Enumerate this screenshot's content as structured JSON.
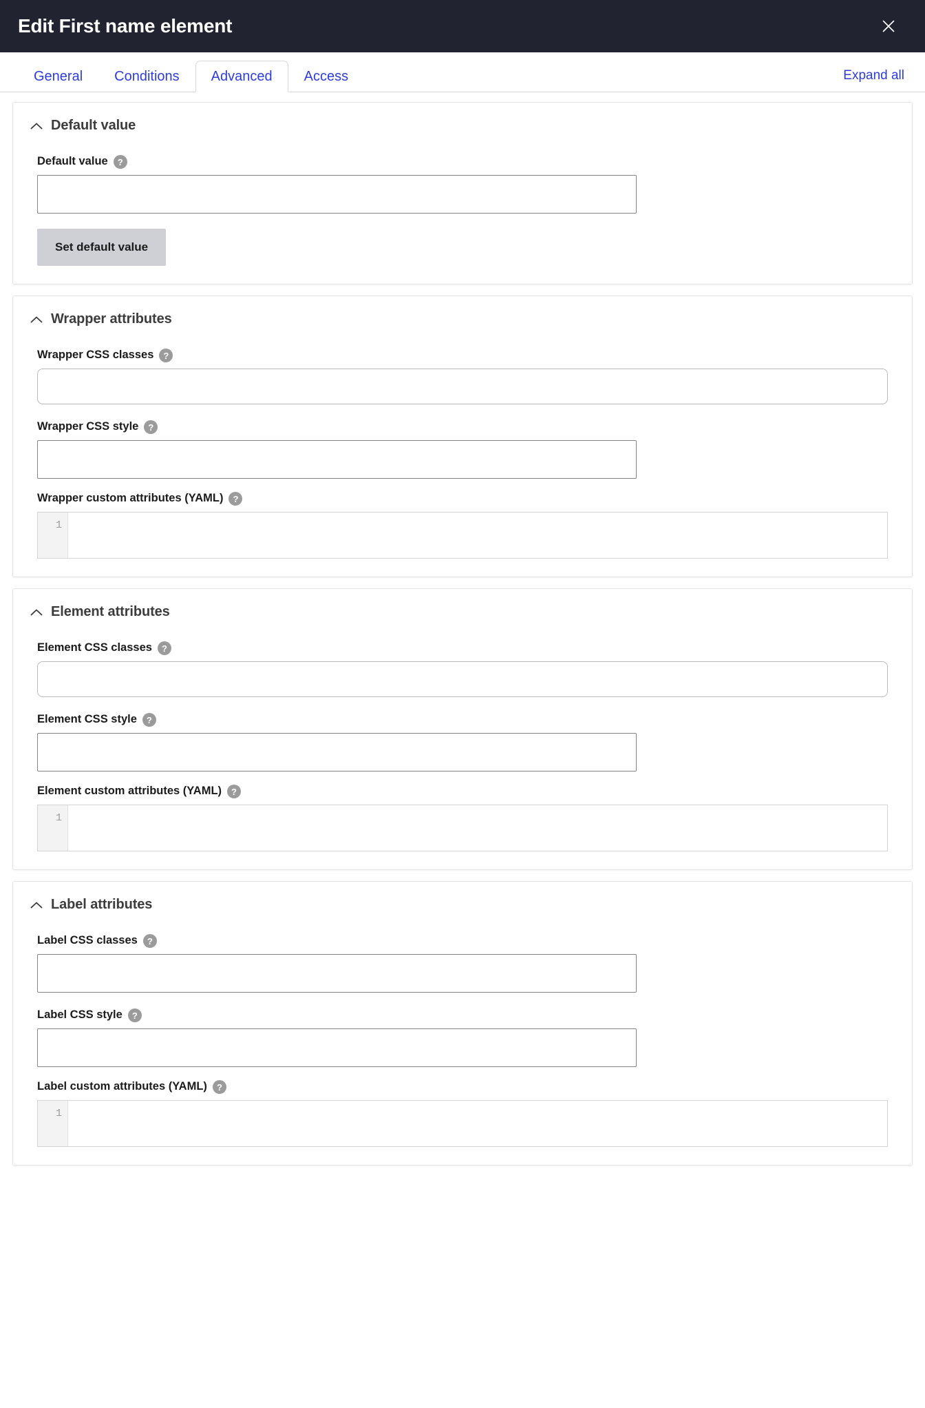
{
  "header": {
    "title": "Edit First name element",
    "close_label": "×",
    "close_icon": "close-icon",
    "background": "#222330"
  },
  "tabs": {
    "items": [
      {
        "label": "General",
        "active": false
      },
      {
        "label": "Conditions",
        "active": false
      },
      {
        "label": "Advanced",
        "active": true
      },
      {
        "label": "Access",
        "active": false
      }
    ],
    "expand_all_label": "Expand all",
    "link_color": "#2c3cdd"
  },
  "panels": [
    {
      "id": "default-value",
      "title": "Default value",
      "chevron_icon": "chevron-up-icon",
      "fields": [
        {
          "id": "default-value",
          "label": "Default value",
          "help_icon": "help-icon",
          "help_glyph": "?",
          "value": "",
          "placeholder": "",
          "kind": "text",
          "width": "medium"
        }
      ],
      "button": {
        "label": "Set default value"
      }
    },
    {
      "id": "wrapper-attributes",
      "title": "Wrapper attributes",
      "chevron_icon": "chevron-up-icon",
      "fields": [
        {
          "id": "wrapper-css-classes",
          "label": "Wrapper CSS classes",
          "help_icon": "help-icon",
          "help_glyph": "?",
          "value": "",
          "placeholder": "",
          "kind": "select",
          "width": "full"
        },
        {
          "id": "wrapper-css-style",
          "label": "Wrapper CSS style",
          "help_icon": "help-icon",
          "help_glyph": "?",
          "value": "",
          "placeholder": "",
          "kind": "text",
          "width": "medium"
        },
        {
          "id": "wrapper-custom-attributes",
          "label": "Wrapper custom attributes (YAML)",
          "help_icon": "help-icon",
          "help_glyph": "?",
          "value": "",
          "kind": "code",
          "line_number": "1",
          "width": "full"
        }
      ]
    },
    {
      "id": "element-attributes",
      "title": "Element attributes",
      "chevron_icon": "chevron-up-icon",
      "fields": [
        {
          "id": "element-css-classes",
          "label": "Element CSS classes",
          "help_icon": "help-icon",
          "help_glyph": "?",
          "value": "",
          "placeholder": "",
          "kind": "select",
          "width": "full"
        },
        {
          "id": "element-css-style",
          "label": "Element CSS style",
          "help_icon": "help-icon",
          "help_glyph": "?",
          "value": "",
          "placeholder": "",
          "kind": "text",
          "width": "medium"
        },
        {
          "id": "element-custom-attributes",
          "label": "Element custom attributes (YAML)",
          "help_icon": "help-icon",
          "help_glyph": "?",
          "value": "",
          "kind": "code",
          "line_number": "1",
          "width": "full"
        }
      ]
    },
    {
      "id": "label-attributes",
      "title": "Label attributes",
      "chevron_icon": "chevron-up-icon",
      "fields": [
        {
          "id": "label-css-classes",
          "label": "Label CSS classes",
          "help_icon": "help-icon",
          "help_glyph": "?",
          "value": "",
          "placeholder": "",
          "kind": "text",
          "width": "medium"
        },
        {
          "id": "label-css-style",
          "label": "Label CSS style",
          "help_icon": "help-icon",
          "help_glyph": "?",
          "value": "",
          "placeholder": "",
          "kind": "text",
          "width": "medium"
        },
        {
          "id": "label-custom-attributes",
          "label": "Label custom attributes (YAML)",
          "help_icon": "help-icon",
          "help_glyph": "?",
          "value": "",
          "kind": "code",
          "line_number": "1",
          "width": "full"
        }
      ]
    }
  ]
}
